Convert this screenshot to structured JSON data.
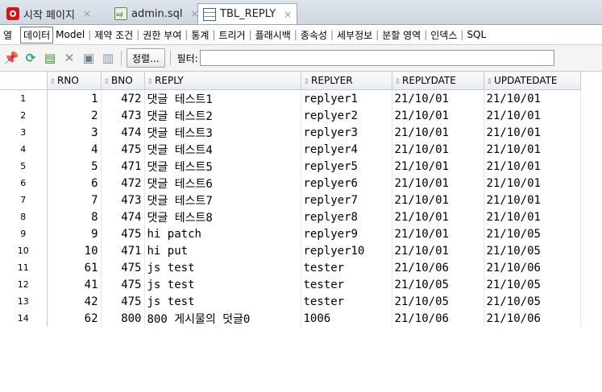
{
  "editor_tabs": [
    {
      "label": "시작 페이지",
      "icon": "start-page-icon"
    },
    {
      "label": "admin.sql",
      "icon": "sql-file-icon"
    },
    {
      "label": "TBL_REPLY",
      "icon": "table-icon"
    }
  ],
  "subtabs": {
    "column_label": "열",
    "items": [
      "데이터",
      "Model",
      "제약 조건",
      "권한 부여",
      "통계",
      "트리거",
      "플래시백",
      "종속성",
      "세부정보",
      "분할 영역",
      "인덱스",
      "SQL"
    ]
  },
  "toolbar": {
    "sort_label": "정렬...",
    "filter_label": "필터:",
    "filter_value": ""
  },
  "grid": {
    "columns": [
      "RNO",
      "BNO",
      "REPLY",
      "REPLYER",
      "REPLYDATE",
      "UPDATEDATE"
    ],
    "rows": [
      {
        "n": "1",
        "rno": "1",
        "bno": "472",
        "reply": "댓글 테스트1",
        "replyer": "replyer1",
        "replydate": "21/10/01",
        "updatedate": "21/10/01"
      },
      {
        "n": "2",
        "rno": "2",
        "bno": "473",
        "reply": "댓글 테스트2",
        "replyer": "replyer2",
        "replydate": "21/10/01",
        "updatedate": "21/10/01"
      },
      {
        "n": "3",
        "rno": "3",
        "bno": "474",
        "reply": "댓글 테스트3",
        "replyer": "replyer3",
        "replydate": "21/10/01",
        "updatedate": "21/10/01"
      },
      {
        "n": "4",
        "rno": "4",
        "bno": "475",
        "reply": "댓글 테스트4",
        "replyer": "replyer4",
        "replydate": "21/10/01",
        "updatedate": "21/10/01"
      },
      {
        "n": "5",
        "rno": "5",
        "bno": "471",
        "reply": "댓글 테스트5",
        "replyer": "replyer5",
        "replydate": "21/10/01",
        "updatedate": "21/10/01"
      },
      {
        "n": "6",
        "rno": "6",
        "bno": "472",
        "reply": "댓글 테스트6",
        "replyer": "replyer6",
        "replydate": "21/10/01",
        "updatedate": "21/10/01"
      },
      {
        "n": "7",
        "rno": "7",
        "bno": "473",
        "reply": "댓글 테스트7",
        "replyer": "replyer7",
        "replydate": "21/10/01",
        "updatedate": "21/10/01"
      },
      {
        "n": "8",
        "rno": "8",
        "bno": "474",
        "reply": "댓글 테스트8",
        "replyer": "replyer8",
        "replydate": "21/10/01",
        "updatedate": "21/10/01"
      },
      {
        "n": "9",
        "rno": "9",
        "bno": "475",
        "reply": "hi patch",
        "replyer": "replyer9",
        "replydate": "21/10/01",
        "updatedate": "21/10/05"
      },
      {
        "n": "10",
        "rno": "10",
        "bno": "471",
        "reply": "hi put",
        "replyer": "replyer10",
        "replydate": "21/10/01",
        "updatedate": "21/10/05"
      },
      {
        "n": "11",
        "rno": "61",
        "bno": "475",
        "reply": "js test",
        "replyer": "tester",
        "replydate": "21/10/06",
        "updatedate": "21/10/06"
      },
      {
        "n": "12",
        "rno": "41",
        "bno": "475",
        "reply": "js test",
        "replyer": "tester",
        "replydate": "21/10/05",
        "updatedate": "21/10/05"
      },
      {
        "n": "13",
        "rno": "42",
        "bno": "475",
        "reply": "js test",
        "replyer": "tester",
        "replydate": "21/10/05",
        "updatedate": "21/10/05"
      },
      {
        "n": "14",
        "rno": "62",
        "bno": "800",
        "reply": "800 게시물의 덧글0",
        "replyer": "1006",
        "replydate": "21/10/06",
        "updatedate": "21/10/06"
      }
    ]
  }
}
